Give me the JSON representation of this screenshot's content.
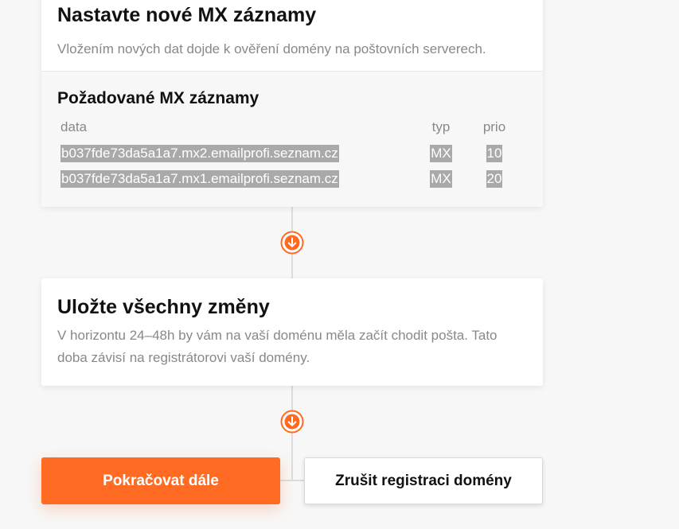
{
  "step_mx": {
    "title": "Nastavte nové MX záznamy",
    "description": "Vložením nových dat dojde k ověření domény na poštovních serverech.",
    "records_title": "Požadované MX záznamy",
    "columns": {
      "data": "data",
      "type": "typ",
      "prio": "prio"
    },
    "records": [
      {
        "data": "b037fde73da5a1a7.mx2.emailprofi.seznam.cz",
        "type": "MX",
        "prio": "10"
      },
      {
        "data": "b037fde73da5a1a7.mx1.emailprofi.seznam.cz",
        "type": "MX",
        "prio": "20"
      }
    ]
  },
  "step_save": {
    "title": "Uložte všechny změny",
    "description": "V horizontu 24–48h by vám na vaší doménu měla začít chodit pošta. Tato doba závisí na registrátorovi vaší domény."
  },
  "actions": {
    "continue_label": "Pokračovat dále",
    "cancel_label": "Zrušit registraci domény"
  },
  "icons": {
    "step_arrow": "arrow-down-circle-icon"
  },
  "colors": {
    "accent": "#ff6b22",
    "selection": "#a9a9a9"
  }
}
